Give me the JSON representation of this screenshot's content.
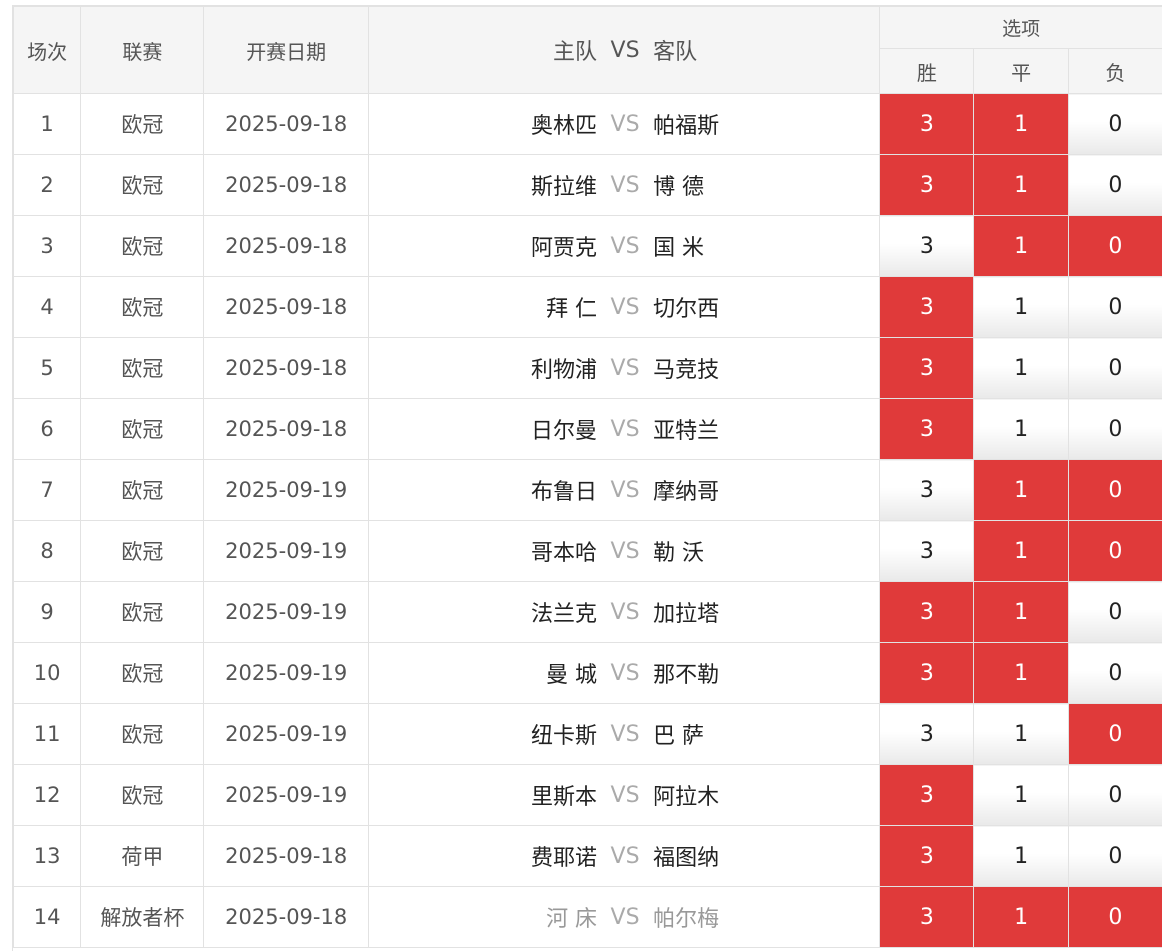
{
  "header": {
    "no": "场次",
    "league": "联赛",
    "date": "开赛日期",
    "home": "主队",
    "vs": "VS",
    "away": "客队",
    "options": "选项",
    "win": "胜",
    "draw": "平",
    "lose": "负"
  },
  "colors": {
    "selected": "#e03a3a",
    "border": "#e2e2e2",
    "header_bg": "#f5f5f5"
  },
  "rows": [
    {
      "no": "1",
      "league": "欧冠",
      "date": "2025-09-18",
      "home": "奥林匹",
      "vs": "VS",
      "away": "帕福斯",
      "o3": "3",
      "o1": "1",
      "o0": "0",
      "s3": true,
      "s1": true,
      "s0": false,
      "dim": false
    },
    {
      "no": "2",
      "league": "欧冠",
      "date": "2025-09-18",
      "home": "斯拉维",
      "vs": "VS",
      "away": "博 德",
      "o3": "3",
      "o1": "1",
      "o0": "0",
      "s3": true,
      "s1": true,
      "s0": false,
      "dim": false
    },
    {
      "no": "3",
      "league": "欧冠",
      "date": "2025-09-18",
      "home": "阿贾克",
      "vs": "VS",
      "away": "国 米",
      "o3": "3",
      "o1": "1",
      "o0": "0",
      "s3": false,
      "s1": true,
      "s0": true,
      "dim": false
    },
    {
      "no": "4",
      "league": "欧冠",
      "date": "2025-09-18",
      "home": "拜 仁",
      "vs": "VS",
      "away": "切尔西",
      "o3": "3",
      "o1": "1",
      "o0": "0",
      "s3": true,
      "s1": false,
      "s0": false,
      "dim": false
    },
    {
      "no": "5",
      "league": "欧冠",
      "date": "2025-09-18",
      "home": "利物浦",
      "vs": "VS",
      "away": "马竞技",
      "o3": "3",
      "o1": "1",
      "o0": "0",
      "s3": true,
      "s1": false,
      "s0": false,
      "dim": false
    },
    {
      "no": "6",
      "league": "欧冠",
      "date": "2025-09-18",
      "home": "日尔曼",
      "vs": "VS",
      "away": "亚特兰",
      "o3": "3",
      "o1": "1",
      "o0": "0",
      "s3": true,
      "s1": false,
      "s0": false,
      "dim": false
    },
    {
      "no": "7",
      "league": "欧冠",
      "date": "2025-09-19",
      "home": "布鲁日",
      "vs": "VS",
      "away": "摩纳哥",
      "o3": "3",
      "o1": "1",
      "o0": "0",
      "s3": false,
      "s1": true,
      "s0": true,
      "dim": false
    },
    {
      "no": "8",
      "league": "欧冠",
      "date": "2025-09-19",
      "home": "哥本哈",
      "vs": "VS",
      "away": "勒 沃",
      "o3": "3",
      "o1": "1",
      "o0": "0",
      "s3": false,
      "s1": true,
      "s0": true,
      "dim": false
    },
    {
      "no": "9",
      "league": "欧冠",
      "date": "2025-09-19",
      "home": "法兰克",
      "vs": "VS",
      "away": "加拉塔",
      "o3": "3",
      "o1": "1",
      "o0": "0",
      "s3": true,
      "s1": true,
      "s0": false,
      "dim": false
    },
    {
      "no": "10",
      "league": "欧冠",
      "date": "2025-09-19",
      "home": "曼 城",
      "vs": "VS",
      "away": "那不勒",
      "o3": "3",
      "o1": "1",
      "o0": "0",
      "s3": true,
      "s1": true,
      "s0": false,
      "dim": false
    },
    {
      "no": "11",
      "league": "欧冠",
      "date": "2025-09-19",
      "home": "纽卡斯",
      "vs": "VS",
      "away": "巴 萨",
      "o3": "3",
      "o1": "1",
      "o0": "0",
      "s3": false,
      "s1": false,
      "s0": true,
      "dim": false
    },
    {
      "no": "12",
      "league": "欧冠",
      "date": "2025-09-19",
      "home": "里斯本",
      "vs": "VS",
      "away": "阿拉木",
      "o3": "3",
      "o1": "1",
      "o0": "0",
      "s3": true,
      "s1": false,
      "s0": false,
      "dim": false
    },
    {
      "no": "13",
      "league": "荷甲",
      "date": "2025-09-18",
      "home": "费耶诺",
      "vs": "VS",
      "away": "福图纳",
      "o3": "3",
      "o1": "1",
      "o0": "0",
      "s3": true,
      "s1": false,
      "s0": false,
      "dim": false
    },
    {
      "no": "14",
      "league": "解放者杯",
      "date": "2025-09-18",
      "home": "河 床",
      "vs": "VS",
      "away": "帕尔梅",
      "o3": "3",
      "o1": "1",
      "o0": "0",
      "s3": true,
      "s1": true,
      "s0": true,
      "dim": true
    }
  ]
}
